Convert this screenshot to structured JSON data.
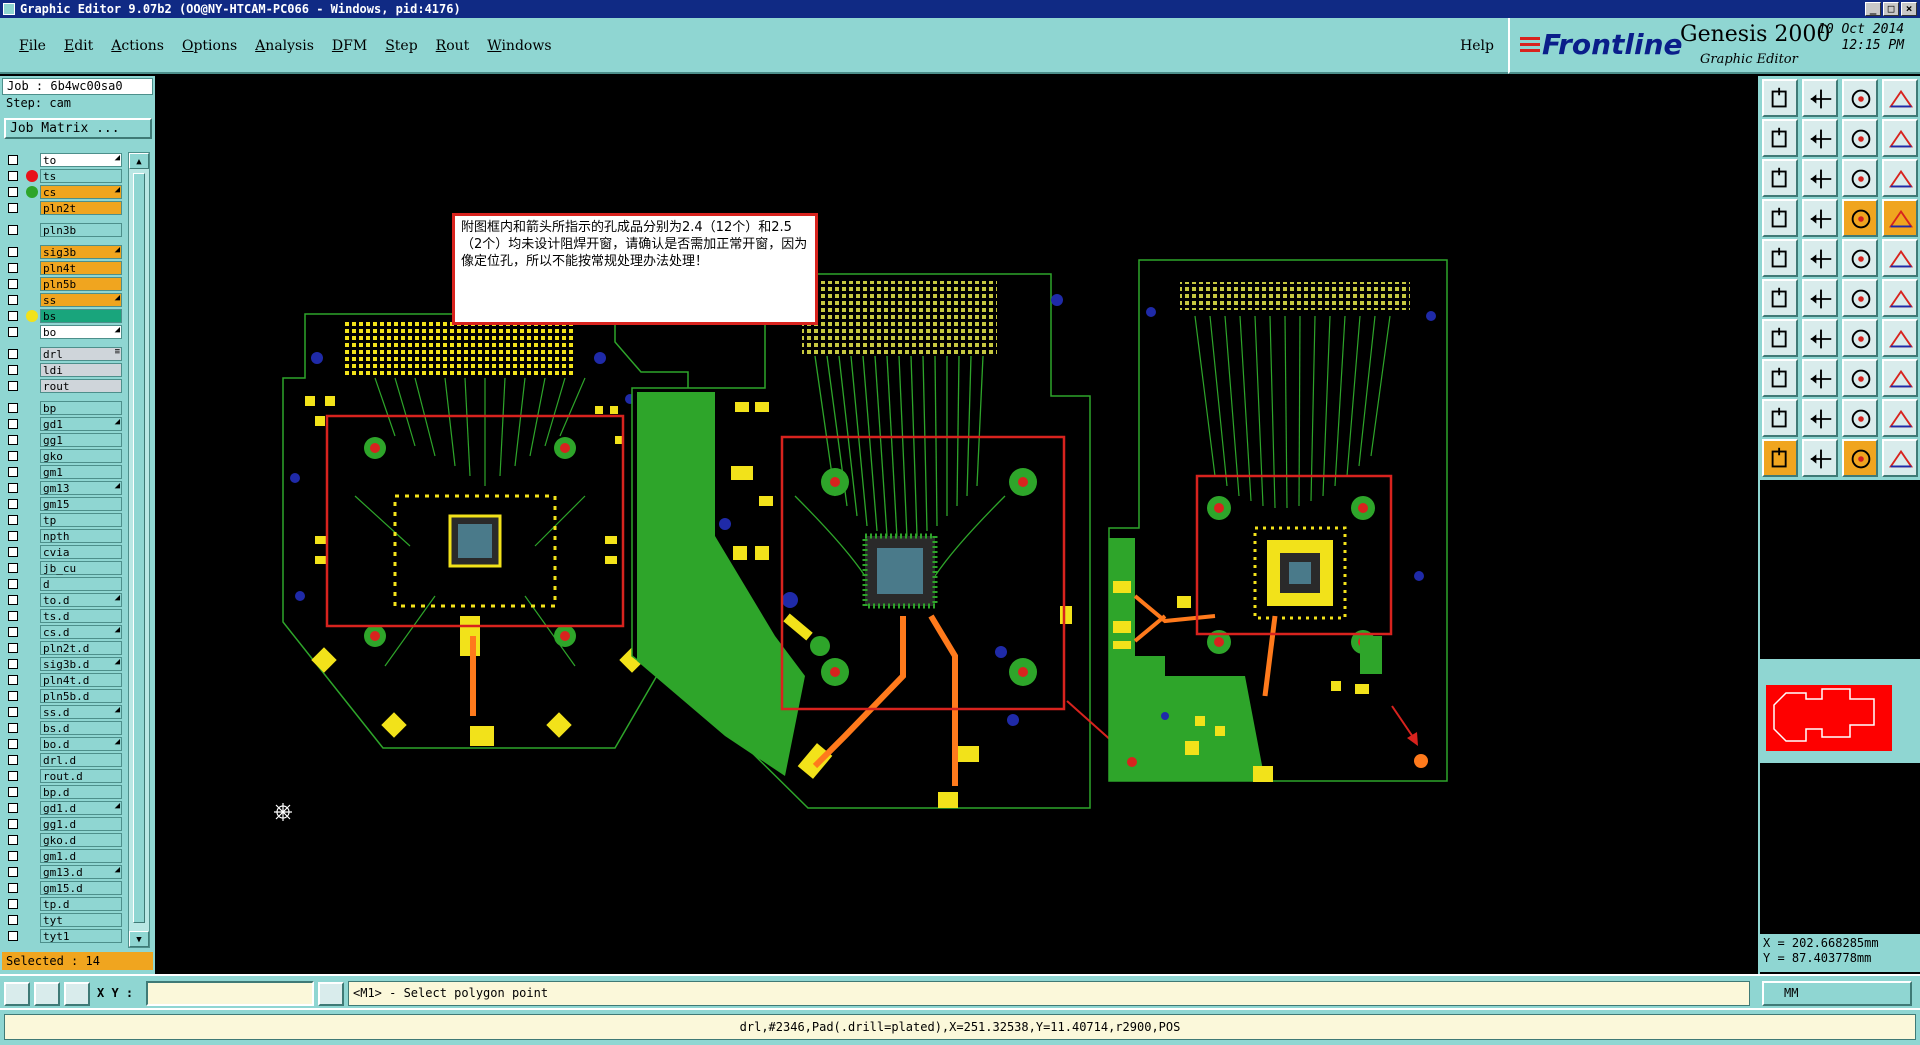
{
  "window": {
    "title": "Graphic Editor 9.07b2 (OO@NY-HTCAM-PC066 - Windows, pid:4176)"
  },
  "menu": {
    "items": [
      "File",
      "Edit",
      "Actions",
      "Options",
      "Analysis",
      "DFM",
      "Step",
      "Rout",
      "Windows"
    ],
    "help": "Help"
  },
  "brand": {
    "logo": "Frontline",
    "product": "Genesis 2000",
    "subtitle": "Graphic Editor",
    "date": "10 Oct 2014",
    "time": "12:15 PM"
  },
  "left": {
    "job": "Job : 6b4wc00sa0",
    "step": "Step: cam",
    "job_matrix": "Job Matrix ...",
    "selected": "Selected : 14"
  },
  "layers": [
    {
      "name": "to",
      "color": "#ffffff",
      "dot": "",
      "mark": "◢"
    },
    {
      "name": "ts",
      "color": "#8fd6d2",
      "dot": "#e8131a",
      "mark": ""
    },
    {
      "name": "cs",
      "color": "#f0a51f",
      "dot": "#2ea52a",
      "mark": "◢"
    },
    {
      "name": "pln2t",
      "color": "#f0a51f",
      "dot": "",
      "mark": ""
    },
    {
      "sep": true
    },
    {
      "name": "pln3b",
      "color": "#8fd6d2",
      "dot": "",
      "mark": ""
    },
    {
      "sep": true
    },
    {
      "name": "sig3b",
      "color": "#f0a51f",
      "dot": "",
      "mark": "◢"
    },
    {
      "name": "pln4t",
      "color": "#f0a51f",
      "dot": "",
      "mark": ""
    },
    {
      "name": "pln5b",
      "color": "#f0a51f",
      "dot": "",
      "mark": ""
    },
    {
      "name": "ss",
      "color": "#f0a51f",
      "dot": "",
      "mark": "◢"
    },
    {
      "name": "bs",
      "color": "#19a57c",
      "dot": "#f2e21a",
      "mark": ""
    },
    {
      "name": "bo",
      "color": "#ffffff",
      "dot": "",
      "mark": "◢"
    },
    {
      "sep": true
    },
    {
      "name": "drl",
      "color": "#cfd5da",
      "dot": "",
      "mark": "≡"
    },
    {
      "name": "ldi",
      "color": "#cfd5da",
      "dot": "",
      "mark": ""
    },
    {
      "name": "rout",
      "color": "#cfd5da",
      "dot": "",
      "mark": ""
    },
    {
      "sep": true
    },
    {
      "name": "bp",
      "color": "#8fd6d2",
      "dot": "",
      "mark": ""
    },
    {
      "name": "gd1",
      "color": "#8fd6d2",
      "dot": "",
      "mark": "◢"
    },
    {
      "name": "gg1",
      "color": "#8fd6d2",
      "dot": "",
      "mark": ""
    },
    {
      "name": "gko",
      "color": "#8fd6d2",
      "dot": "",
      "mark": ""
    },
    {
      "name": "gm1",
      "color": "#8fd6d2",
      "dot": "",
      "mark": ""
    },
    {
      "name": "gm13",
      "color": "#8fd6d2",
      "dot": "",
      "mark": "◢"
    },
    {
      "name": "gm15",
      "color": "#8fd6d2",
      "dot": "",
      "mark": ""
    },
    {
      "name": "tp",
      "color": "#8fd6d2",
      "dot": "",
      "mark": ""
    },
    {
      "name": "npth",
      "color": "#8fd6d2",
      "dot": "",
      "mark": ""
    },
    {
      "name": "cvia",
      "color": "#8fd6d2",
      "dot": "",
      "mark": ""
    },
    {
      "name": "jb_cu",
      "color": "#8fd6d2",
      "dot": "",
      "mark": ""
    },
    {
      "name": "d",
      "color": "#8fd6d2",
      "dot": "",
      "mark": ""
    },
    {
      "name": "to.d",
      "color": "#8fd6d2",
      "dot": "",
      "mark": "◢"
    },
    {
      "name": "ts.d",
      "color": "#8fd6d2",
      "dot": "",
      "mark": ""
    },
    {
      "name": "cs.d",
      "color": "#8fd6d2",
      "dot": "",
      "mark": "◢"
    },
    {
      "name": "pln2t.d",
      "color": "#8fd6d2",
      "dot": "",
      "mark": ""
    },
    {
      "name": "sig3b.d",
      "color": "#8fd6d2",
      "dot": "",
      "mark": "◢"
    },
    {
      "name": "pln4t.d",
      "color": "#8fd6d2",
      "dot": "",
      "mark": ""
    },
    {
      "name": "pln5b.d",
      "color": "#8fd6d2",
      "dot": "",
      "mark": ""
    },
    {
      "name": "ss.d",
      "color": "#8fd6d2",
      "dot": "",
      "mark": "◢"
    },
    {
      "name": "bs.d",
      "color": "#8fd6d2",
      "dot": "",
      "mark": ""
    },
    {
      "name": "bo.d",
      "color": "#8fd6d2",
      "dot": "",
      "mark": "◢"
    },
    {
      "name": "drl.d",
      "color": "#8fd6d2",
      "dot": "",
      "mark": ""
    },
    {
      "name": "rout.d",
      "color": "#8fd6d2",
      "dot": "",
      "mark": ""
    },
    {
      "name": "bp.d",
      "color": "#8fd6d2",
      "dot": "",
      "mark": ""
    },
    {
      "name": "gd1.d",
      "color": "#8fd6d2",
      "dot": "",
      "mark": "◢"
    },
    {
      "name": "gg1.d",
      "color": "#8fd6d2",
      "dot": "",
      "mark": ""
    },
    {
      "name": "gko.d",
      "color": "#8fd6d2",
      "dot": "",
      "mark": ""
    },
    {
      "name": "gm1.d",
      "color": "#8fd6d2",
      "dot": "",
      "mark": ""
    },
    {
      "name": "gm13.d",
      "color": "#8fd6d2",
      "dot": "",
      "mark": "◢"
    },
    {
      "name": "gm15.d",
      "color": "#8fd6d2",
      "dot": "",
      "mark": ""
    },
    {
      "name": "tp.d",
      "color": "#8fd6d2",
      "dot": "",
      "mark": ""
    },
    {
      "name": "tyt",
      "color": "#8fd6d2",
      "dot": "",
      "mark": ""
    },
    {
      "name": "tyt1",
      "color": "#8fd6d2",
      "dot": "",
      "mark": ""
    }
  ],
  "annotation": {
    "text": "附图框内和箭头所指示的孔成品分别为2.4（12个）和2.5（2个）均未设计阻焊开窗，请确认是否需加正常开窗，因为像定位孔，所以不能按常规处理办法处理！"
  },
  "coords": {
    "x": "X = 202.668285mm",
    "y": "Y = 87.403778mm"
  },
  "status": {
    "xy_label": "X Y :",
    "xy_value": "",
    "prompt": "<M1> - Select polygon point",
    "units": "MM",
    "info": "drl,#2346,Pad(.drill=plated),X=251.32538,Y=11.40714,r2900,POS"
  },
  "colors": {
    "panel": "#8fd6d2",
    "board": "#2ea52a",
    "copper": "#f2e21a",
    "highlight": "#d8231e",
    "trace": "#ff7a1c",
    "pad_blue": "#1f2aa8"
  },
  "icons": {
    "tools": [
      "zoom-home-icon",
      "zoom-in-icon",
      "home-icon",
      "zoom-fit-icon",
      "pan-left-icon",
      "pan-right-icon",
      "mirror-icon",
      "rotate-icon",
      "fit-all-icon",
      "center-icon",
      "scale-icon",
      "zoom-area-icon",
      "measure-icon",
      "probe-icon",
      "layer-a-icon",
      "layer-b-icon",
      "select-pad-icon",
      "select-area-icon",
      "line-icon",
      "circle-icon",
      "node-icon",
      "cross-icon",
      "connect-icon",
      "branch-icon",
      "angle-icon",
      "slope-icon",
      "arc-icon",
      "text-icon",
      "add-pad-icon",
      "minus-icon",
      "frame-icon",
      "group-icon",
      "triangle-icon",
      "triangle-b-icon",
      "triangle-c-icon",
      "triangle-d-icon",
      "pointer-icon",
      "pointer-b-icon",
      "pointer-c-icon",
      "pointer-d-icon"
    ]
  }
}
